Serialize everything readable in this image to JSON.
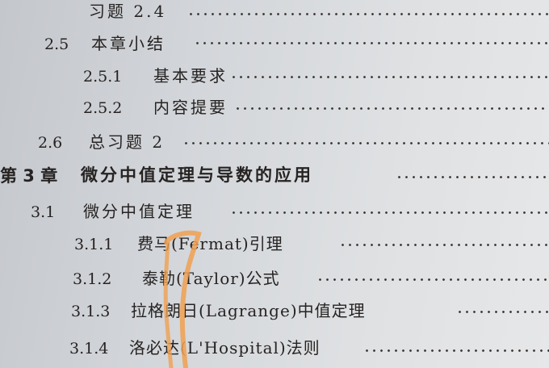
{
  "toc": [
    {
      "number": "",
      "title": "习题 2.4"
    },
    {
      "number": "2.5",
      "title": "本章小结"
    },
    {
      "number": "2.5.1",
      "title": "基本要求"
    },
    {
      "number": "2.5.2",
      "title": "内容提要"
    },
    {
      "number": "2.6",
      "title": "总习题 2"
    },
    {
      "number": "第 3 章",
      "title": "微分中值定理与导数的应用"
    },
    {
      "number": "3.1",
      "title": "微分中值定理"
    },
    {
      "number": "3.1.1",
      "title": "费马(Fermat)引理"
    },
    {
      "number": "3.1.2",
      "title": "泰勒(Taylor)公式"
    },
    {
      "number": "3.1.3",
      "title": "拉格朗日(Lagrange)中值定理"
    },
    {
      "number": "3.1.4",
      "title": "洛必达(L'Hospital)法则"
    }
  ],
  "colors": {
    "marker": "#f0a050",
    "ink": "#262322"
  }
}
